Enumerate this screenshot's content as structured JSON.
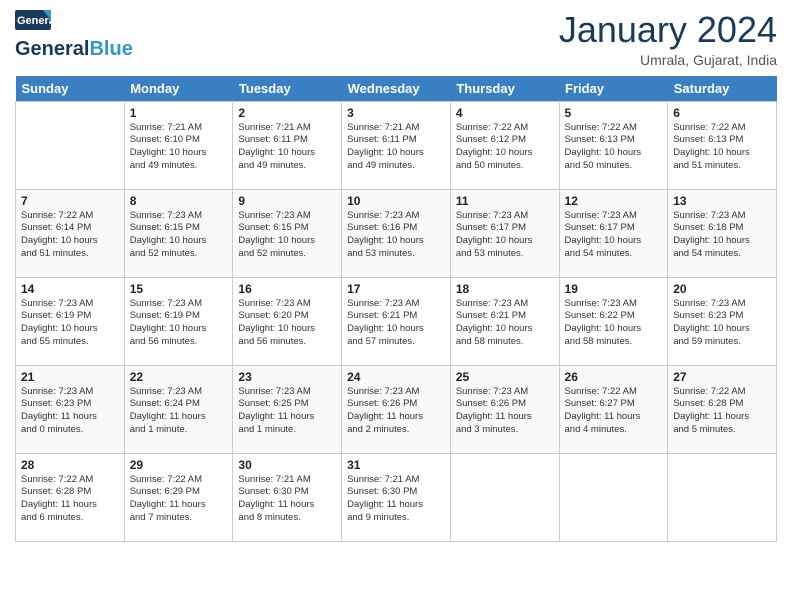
{
  "header": {
    "logo_general": "General",
    "logo_blue": "Blue",
    "title": "January 2024",
    "location": "Umrala, Gujarat, India"
  },
  "days_header": [
    "Sunday",
    "Monday",
    "Tuesday",
    "Wednesday",
    "Thursday",
    "Friday",
    "Saturday"
  ],
  "weeks": [
    [
      {
        "num": "",
        "info": ""
      },
      {
        "num": "1",
        "info": "Sunrise: 7:21 AM\nSunset: 6:10 PM\nDaylight: 10 hours\nand 49 minutes."
      },
      {
        "num": "2",
        "info": "Sunrise: 7:21 AM\nSunset: 6:11 PM\nDaylight: 10 hours\nand 49 minutes."
      },
      {
        "num": "3",
        "info": "Sunrise: 7:21 AM\nSunset: 6:11 PM\nDaylight: 10 hours\nand 49 minutes."
      },
      {
        "num": "4",
        "info": "Sunrise: 7:22 AM\nSunset: 6:12 PM\nDaylight: 10 hours\nand 50 minutes."
      },
      {
        "num": "5",
        "info": "Sunrise: 7:22 AM\nSunset: 6:13 PM\nDaylight: 10 hours\nand 50 minutes."
      },
      {
        "num": "6",
        "info": "Sunrise: 7:22 AM\nSunset: 6:13 PM\nDaylight: 10 hours\nand 51 minutes."
      }
    ],
    [
      {
        "num": "7",
        "info": "Sunrise: 7:22 AM\nSunset: 6:14 PM\nDaylight: 10 hours\nand 51 minutes."
      },
      {
        "num": "8",
        "info": "Sunrise: 7:23 AM\nSunset: 6:15 PM\nDaylight: 10 hours\nand 52 minutes."
      },
      {
        "num": "9",
        "info": "Sunrise: 7:23 AM\nSunset: 6:15 PM\nDaylight: 10 hours\nand 52 minutes."
      },
      {
        "num": "10",
        "info": "Sunrise: 7:23 AM\nSunset: 6:16 PM\nDaylight: 10 hours\nand 53 minutes."
      },
      {
        "num": "11",
        "info": "Sunrise: 7:23 AM\nSunset: 6:17 PM\nDaylight: 10 hours\nand 53 minutes."
      },
      {
        "num": "12",
        "info": "Sunrise: 7:23 AM\nSunset: 6:17 PM\nDaylight: 10 hours\nand 54 minutes."
      },
      {
        "num": "13",
        "info": "Sunrise: 7:23 AM\nSunset: 6:18 PM\nDaylight: 10 hours\nand 54 minutes."
      }
    ],
    [
      {
        "num": "14",
        "info": "Sunrise: 7:23 AM\nSunset: 6:19 PM\nDaylight: 10 hours\nand 55 minutes."
      },
      {
        "num": "15",
        "info": "Sunrise: 7:23 AM\nSunset: 6:19 PM\nDaylight: 10 hours\nand 56 minutes."
      },
      {
        "num": "16",
        "info": "Sunrise: 7:23 AM\nSunset: 6:20 PM\nDaylight: 10 hours\nand 56 minutes."
      },
      {
        "num": "17",
        "info": "Sunrise: 7:23 AM\nSunset: 6:21 PM\nDaylight: 10 hours\nand 57 minutes."
      },
      {
        "num": "18",
        "info": "Sunrise: 7:23 AM\nSunset: 6:21 PM\nDaylight: 10 hours\nand 58 minutes."
      },
      {
        "num": "19",
        "info": "Sunrise: 7:23 AM\nSunset: 6:22 PM\nDaylight: 10 hours\nand 58 minutes."
      },
      {
        "num": "20",
        "info": "Sunrise: 7:23 AM\nSunset: 6:23 PM\nDaylight: 10 hours\nand 59 minutes."
      }
    ],
    [
      {
        "num": "21",
        "info": "Sunrise: 7:23 AM\nSunset: 6:23 PM\nDaylight: 11 hours\nand 0 minutes."
      },
      {
        "num": "22",
        "info": "Sunrise: 7:23 AM\nSunset: 6:24 PM\nDaylight: 11 hours\nand 1 minute."
      },
      {
        "num": "23",
        "info": "Sunrise: 7:23 AM\nSunset: 6:25 PM\nDaylight: 11 hours\nand 1 minute."
      },
      {
        "num": "24",
        "info": "Sunrise: 7:23 AM\nSunset: 6:26 PM\nDaylight: 11 hours\nand 2 minutes."
      },
      {
        "num": "25",
        "info": "Sunrise: 7:23 AM\nSunset: 6:26 PM\nDaylight: 11 hours\nand 3 minutes."
      },
      {
        "num": "26",
        "info": "Sunrise: 7:22 AM\nSunset: 6:27 PM\nDaylight: 11 hours\nand 4 minutes."
      },
      {
        "num": "27",
        "info": "Sunrise: 7:22 AM\nSunset: 6:28 PM\nDaylight: 11 hours\nand 5 minutes."
      }
    ],
    [
      {
        "num": "28",
        "info": "Sunrise: 7:22 AM\nSunset: 6:28 PM\nDaylight: 11 hours\nand 6 minutes."
      },
      {
        "num": "29",
        "info": "Sunrise: 7:22 AM\nSunset: 6:29 PM\nDaylight: 11 hours\nand 7 minutes."
      },
      {
        "num": "30",
        "info": "Sunrise: 7:21 AM\nSunset: 6:30 PM\nDaylight: 11 hours\nand 8 minutes."
      },
      {
        "num": "31",
        "info": "Sunrise: 7:21 AM\nSunset: 6:30 PM\nDaylight: 11 hours\nand 9 minutes."
      },
      {
        "num": "",
        "info": ""
      },
      {
        "num": "",
        "info": ""
      },
      {
        "num": "",
        "info": ""
      }
    ]
  ]
}
